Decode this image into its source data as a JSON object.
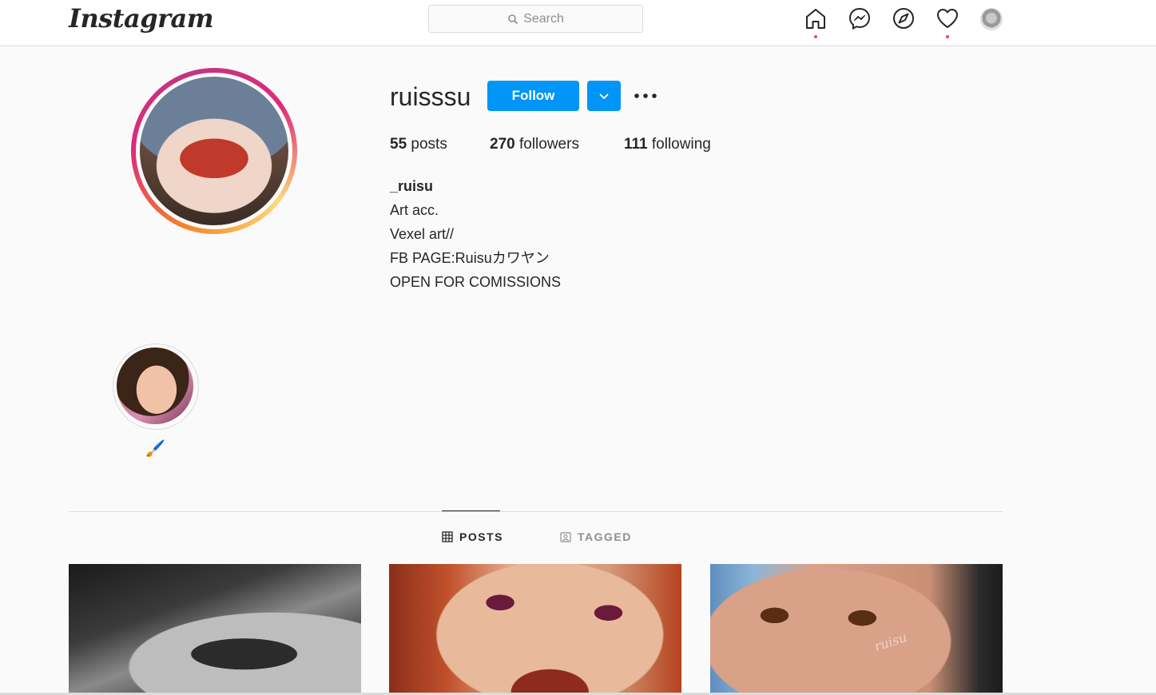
{
  "nav": {
    "logo": "Instagram",
    "search_placeholder": "Search",
    "icons": [
      "home-icon",
      "messenger-icon",
      "explore-icon",
      "activity-heart-icon",
      "profile-avatar"
    ]
  },
  "profile": {
    "username": "ruisssu",
    "follow_label": "Follow",
    "stats": {
      "posts_count": "55",
      "posts_label": "posts",
      "followers_count": "270",
      "followers_label": "followers",
      "following_count": "111",
      "following_label": "following"
    },
    "bio": {
      "name": "_ruisu",
      "lines": [
        "Art acc.",
        "Vexel art//",
        "FB PAGE:Ruisuカワヤン",
        "OPEN FOR COMISSIONS"
      ]
    }
  },
  "highlights": [
    {
      "label": "🖌️"
    }
  ],
  "tabs": [
    {
      "label": "POSTS",
      "active": true
    },
    {
      "label": "TAGGED",
      "active": false
    }
  ],
  "posts": [
    {
      "watermark": ""
    },
    {
      "watermark": ""
    },
    {
      "watermark": "ruisu"
    }
  ],
  "colors": {
    "accent": "#0095f6",
    "notification_dot": "#ed4956",
    "background": "#fafafa"
  }
}
